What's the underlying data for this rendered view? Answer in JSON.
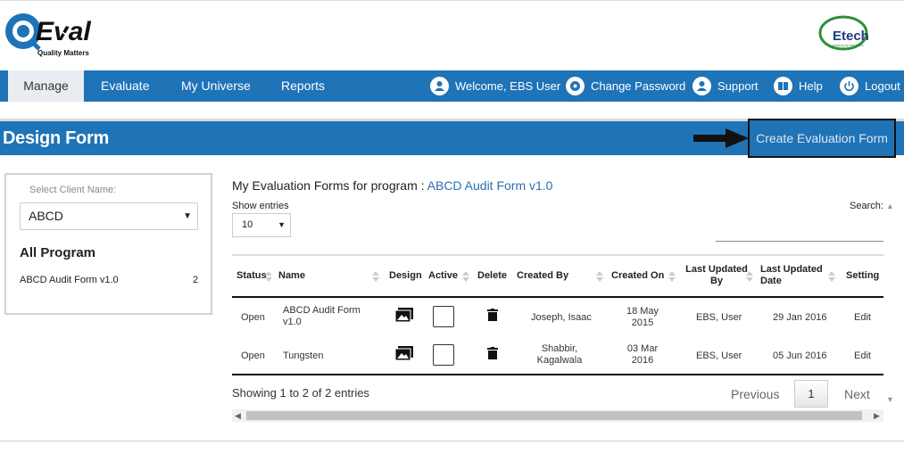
{
  "header": {
    "logo_left_text": "Q-Eval",
    "logo_left_tagline": "Quality Matters",
    "logo_right_text": "Etech",
    "logo_right_tagline": "playing by the rules"
  },
  "nav": {
    "tabs": [
      {
        "label": "Manage",
        "active": true
      },
      {
        "label": "Evaluate",
        "active": false
      },
      {
        "label": "My Universe",
        "active": false
      },
      {
        "label": "Reports",
        "active": false
      }
    ],
    "right": [
      {
        "label": "Welcome, EBS User",
        "icon": "user-icon"
      },
      {
        "label": "Change Password",
        "icon": "gear-icon"
      },
      {
        "label": "Support",
        "icon": "support-icon"
      },
      {
        "label": "Help",
        "icon": "book-icon"
      },
      {
        "label": "Logout",
        "icon": "power-icon"
      }
    ]
  },
  "page": {
    "title": "Design Form",
    "create_button": "Create Evaluation Form"
  },
  "left_panel": {
    "client_label": "Select Client Name:",
    "client_value": "ABCD",
    "all_program": "All Program",
    "program_name": "ABCD Audit Form v1.0",
    "program_count": "2"
  },
  "main": {
    "heading_prefix": "My Evaluation Forms for program :",
    "heading_program": "ABCD Audit Form v1.0",
    "show_entries_label": "Show entries",
    "entries_value": "10",
    "search_label": "Search:",
    "columns": [
      "Status",
      "Name",
      "Design",
      "Active",
      "Delete",
      "Created By",
      "Created On",
      "Last Updated By",
      "Last Updated Date",
      "Setting"
    ],
    "rows": [
      {
        "status": "Open",
        "name": "ABCD Audit Form v1.0",
        "created_by": "Joseph, Isaac",
        "created_on": "18 May 2015",
        "updated_by": "EBS, User",
        "updated_date": "29 Jan 2016",
        "setting": "Edit"
      },
      {
        "status": "Open",
        "name": "Tungsten",
        "created_by": "Shabbir, Kagalwala",
        "created_on": "03 Mar 2016",
        "updated_by": "EBS, User",
        "updated_date": "05 Jun 2016",
        "setting": "Edit"
      }
    ],
    "showing": "Showing 1 to 2 of 2 entries",
    "prev": "Previous",
    "page": "1",
    "next": "Next"
  }
}
